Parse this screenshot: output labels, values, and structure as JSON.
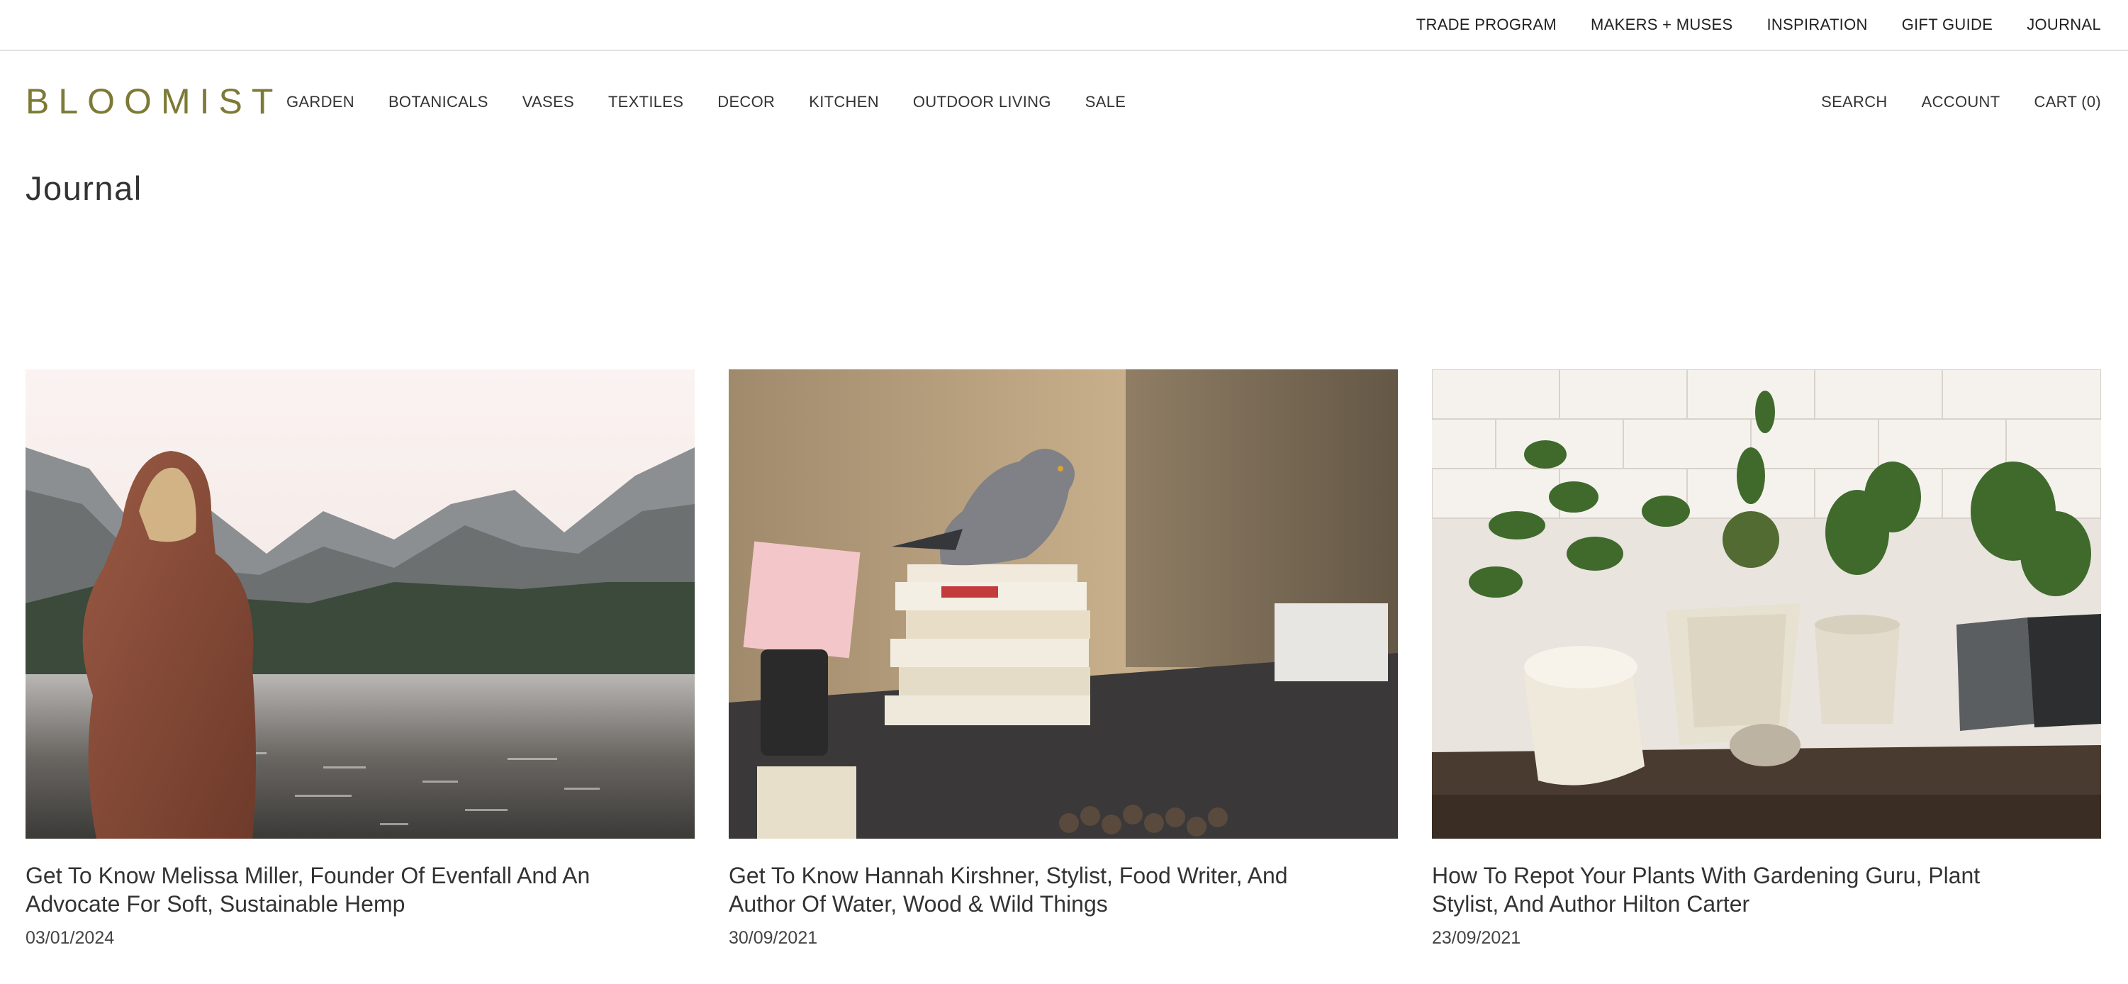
{
  "utility_nav": [
    "TRADE PROGRAM",
    "MAKERS + MUSES",
    "INSPIRATION",
    "GIFT GUIDE",
    "JOURNAL"
  ],
  "brand": {
    "name": "BLOOMIST",
    "color": "#7d7a36"
  },
  "primary_nav": [
    "GARDEN",
    "BOTANICALS",
    "VASES",
    "TEXTILES",
    "DECOR",
    "KITCHEN",
    "OUTDOOR LIVING",
    "SALE"
  ],
  "account_nav": {
    "search": "SEARCH",
    "account": "ACCOUNT",
    "cart": "CART (0)"
  },
  "page": {
    "title": "Journal"
  },
  "articles": [
    {
      "title": "Get To Know Melissa Miller, Founder Of Evenfall And An Advocate For Soft, Sustainable Hemp",
      "date": "03/01/2024"
    },
    {
      "title": "Get To Know Hannah Kirshner, Stylist, Food Writer, And Author Of Water, Wood & Wild Things",
      "date": "30/09/2021"
    },
    {
      "title": "How To Repot Your Plants With Gardening Guru, Plant Stylist, And Author Hilton Carter",
      "date": "23/09/2021"
    }
  ]
}
